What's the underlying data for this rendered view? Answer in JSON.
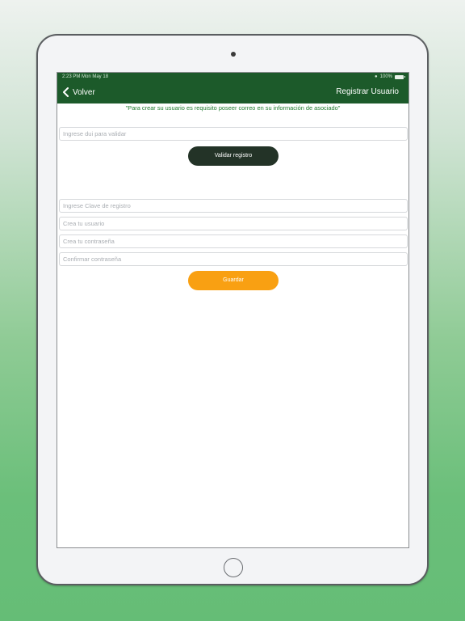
{
  "status_bar": {
    "time": "2:23 PM  Mon May 18",
    "battery": "100%"
  },
  "nav": {
    "back_label": "Volver",
    "title": "Registrar Usuario"
  },
  "notice": "\"Para crear su usuario es requisito poseer correo en su información de asociado\"",
  "dui": {
    "placeholder": "Ingrese dui para validar",
    "value": ""
  },
  "validate_button": "Validar registro",
  "form": {
    "clave_placeholder": "Ingrese Clave de registro",
    "usuario_placeholder": "Crea tu usuario",
    "password_placeholder": "Crea tu contraseña",
    "confirm_placeholder": "Confirmar contraseña"
  },
  "save_button": "Guardar",
  "colors": {
    "header_green": "#1c5a2a",
    "notice_green": "#1f7a2e",
    "validate_dark": "#233327",
    "save_orange": "#f9a012"
  }
}
